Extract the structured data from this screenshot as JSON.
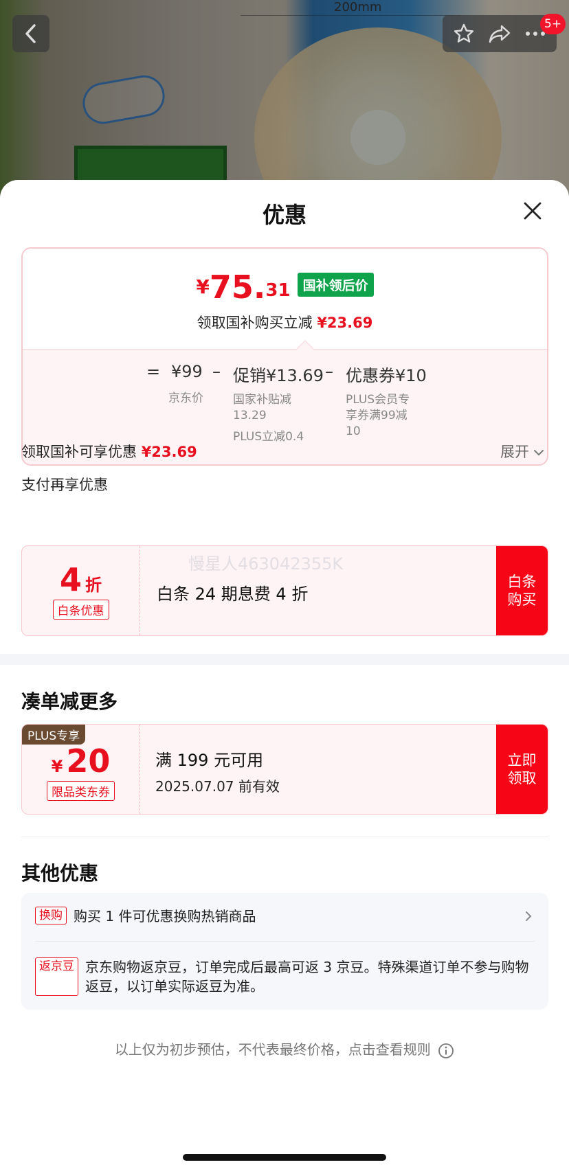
{
  "background": {
    "dimension_label": "200mm",
    "message_count": "5+"
  },
  "sheet": {
    "title": "优惠"
  },
  "price_summary": {
    "currency": "¥",
    "price_int": "75.",
    "price_dec": "31",
    "price_tag": "国补领后价",
    "subtitle": "领取国补购买立减",
    "subtitle_amount": "¥23.69",
    "calc": {
      "equals": "=",
      "jd_price": "¥99",
      "jd_price_label": "京东价",
      "minus1": "–",
      "promo": "促销¥13.69",
      "promo_note_1": "国家补贴减",
      "promo_note_2": "13.29",
      "promo_note_3": "PLUS立减0.4",
      "minus2": "–",
      "coupon": "优惠券¥10",
      "coupon_note_1": "PLUS会员专",
      "coupon_note_2": "享券满99减",
      "coupon_note_3": "10"
    }
  },
  "subsidy_line": {
    "text": "领取国补可享优惠",
    "amount": "¥23.69",
    "expand_label": "展开"
  },
  "pay_section": {
    "title": "支付再享优惠",
    "coupon": {
      "value": "4",
      "unit": "折",
      "tag": "白条优惠",
      "description": "白条 24 期息费 4 折",
      "watermark": "慢星人463042355K",
      "button": "白条\n购买"
    }
  },
  "bundle_section": {
    "title": "凑单减更多",
    "coupon": {
      "plus_tag": "PLUS专享",
      "currency": "¥",
      "value": "20",
      "tag": "限品类东券",
      "condition": "满 199 元可用",
      "expiry": "2025.07.07 前有效",
      "button": "立即\n领取"
    }
  },
  "other_section": {
    "title": "其他优惠",
    "items": [
      {
        "tag": "换购",
        "text": "购买 1 件可优惠换购热销商品"
      },
      {
        "tag": "返京豆",
        "text": "京东购物返京豆，订单完成后最高可返 3 京豆。特殊渠道订单不参与购物返豆，以订单实际返豆为准。"
      }
    ]
  },
  "footnote": "以上仅为初步预估，不代表最终价格，点击查看规则",
  "colors": {
    "accent_red": "#e8101f",
    "button_red": "#f50515",
    "green_tag": "#0fa34b",
    "plus_brown": "#6b4a32"
  }
}
